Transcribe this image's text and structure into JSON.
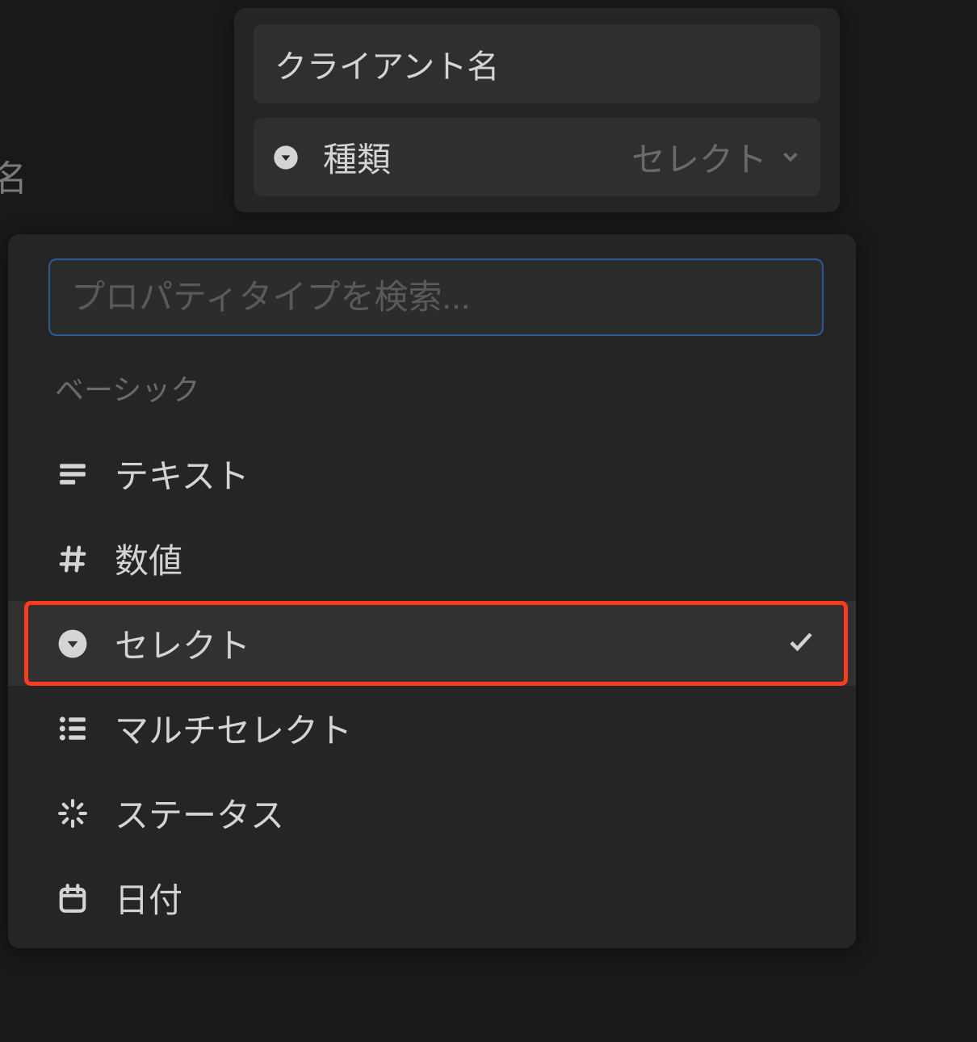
{
  "background": {
    "partial_text": "名"
  },
  "property_config": {
    "name_value": "クライアント名",
    "type_row": {
      "label": "種類",
      "value": "セレクト"
    }
  },
  "type_picker": {
    "search_placeholder": "プロパティタイプを検索...",
    "section_label": "ベーシック",
    "options": [
      {
        "icon": "text",
        "label": "テキスト",
        "selected": false
      },
      {
        "icon": "number",
        "label": "数値",
        "selected": false
      },
      {
        "icon": "select",
        "label": "セレクト",
        "selected": true
      },
      {
        "icon": "multiselect",
        "label": "マルチセレクト",
        "selected": false
      },
      {
        "icon": "status",
        "label": "ステータス",
        "selected": false
      },
      {
        "icon": "date",
        "label": "日付",
        "selected": false
      }
    ]
  }
}
